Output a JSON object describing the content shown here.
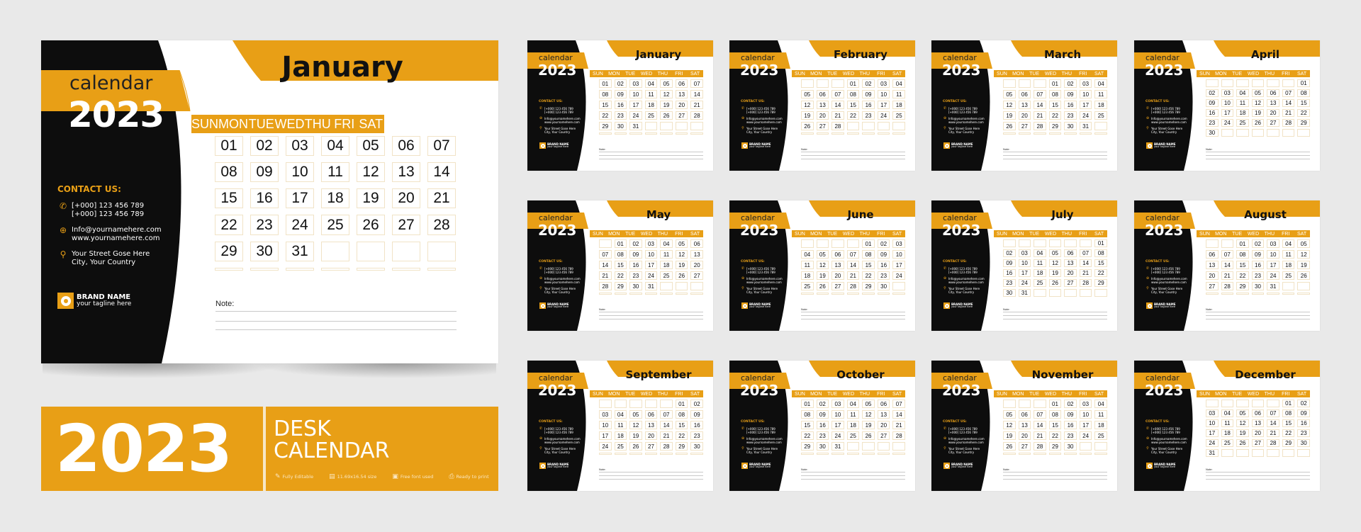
{
  "common": {
    "calendar_word": "calendar",
    "year": "2023",
    "weekdays": [
      "SUN",
      "MON",
      "TUE",
      "WED",
      "THU",
      "FRI",
      "SAT"
    ],
    "contact": {
      "heading": "CONTACT US:",
      "phone_lines": [
        "[+000] 123 456 789",
        "[+000] 123 456 789"
      ],
      "web_lines": [
        "Info@yournamehere.com",
        "www.yournamehere.com"
      ],
      "address_lines": [
        "Your  Street Gose Here",
        "City, Your Country"
      ]
    },
    "brand": {
      "name": "BRAND NAME",
      "tagline": "your tagline here"
    },
    "note_label": "Note:",
    "icons": {
      "phone": "phone-icon",
      "web": "globe-icon",
      "address": "location-pin-icon",
      "logo": "brand-logo-icon"
    }
  },
  "colors": {
    "accent": "#e89f16",
    "dark": "#0d0d0d",
    "background": "#e9e9e9",
    "paper": "#ffffff"
  },
  "featured_month_index": 0,
  "months": [
    {
      "name": "January",
      "first_weekday": 0,
      "days": 31
    },
    {
      "name": "February",
      "first_weekday": 3,
      "days": 28
    },
    {
      "name": "March",
      "first_weekday": 3,
      "days": 31
    },
    {
      "name": "April",
      "first_weekday": 6,
      "days": 30
    },
    {
      "name": "May",
      "first_weekday": 1,
      "days": 31
    },
    {
      "name": "June",
      "first_weekday": 4,
      "days": 30
    },
    {
      "name": "July",
      "first_weekday": 6,
      "days": 31
    },
    {
      "name": "August",
      "first_weekday": 2,
      "days": 31
    },
    {
      "name": "September",
      "first_weekday": 5,
      "days": 30
    },
    {
      "name": "October",
      "first_weekday": 0,
      "days": 31
    },
    {
      "name": "November",
      "first_weekday": 3,
      "days": 30
    },
    {
      "name": "December",
      "first_weekday": 5,
      "days": 31
    }
  ],
  "banner": {
    "year": "2023",
    "title_line1": "DESK",
    "title_line2": "CALENDAR",
    "features": [
      {
        "icon": "pen-icon",
        "label": "Fully Editable"
      },
      {
        "icon": "document-size-icon",
        "label": "11.69x16.54 size"
      },
      {
        "icon": "font-file-icon",
        "label": "Free font used"
      },
      {
        "icon": "printer-icon",
        "label": "Ready to print"
      }
    ]
  }
}
